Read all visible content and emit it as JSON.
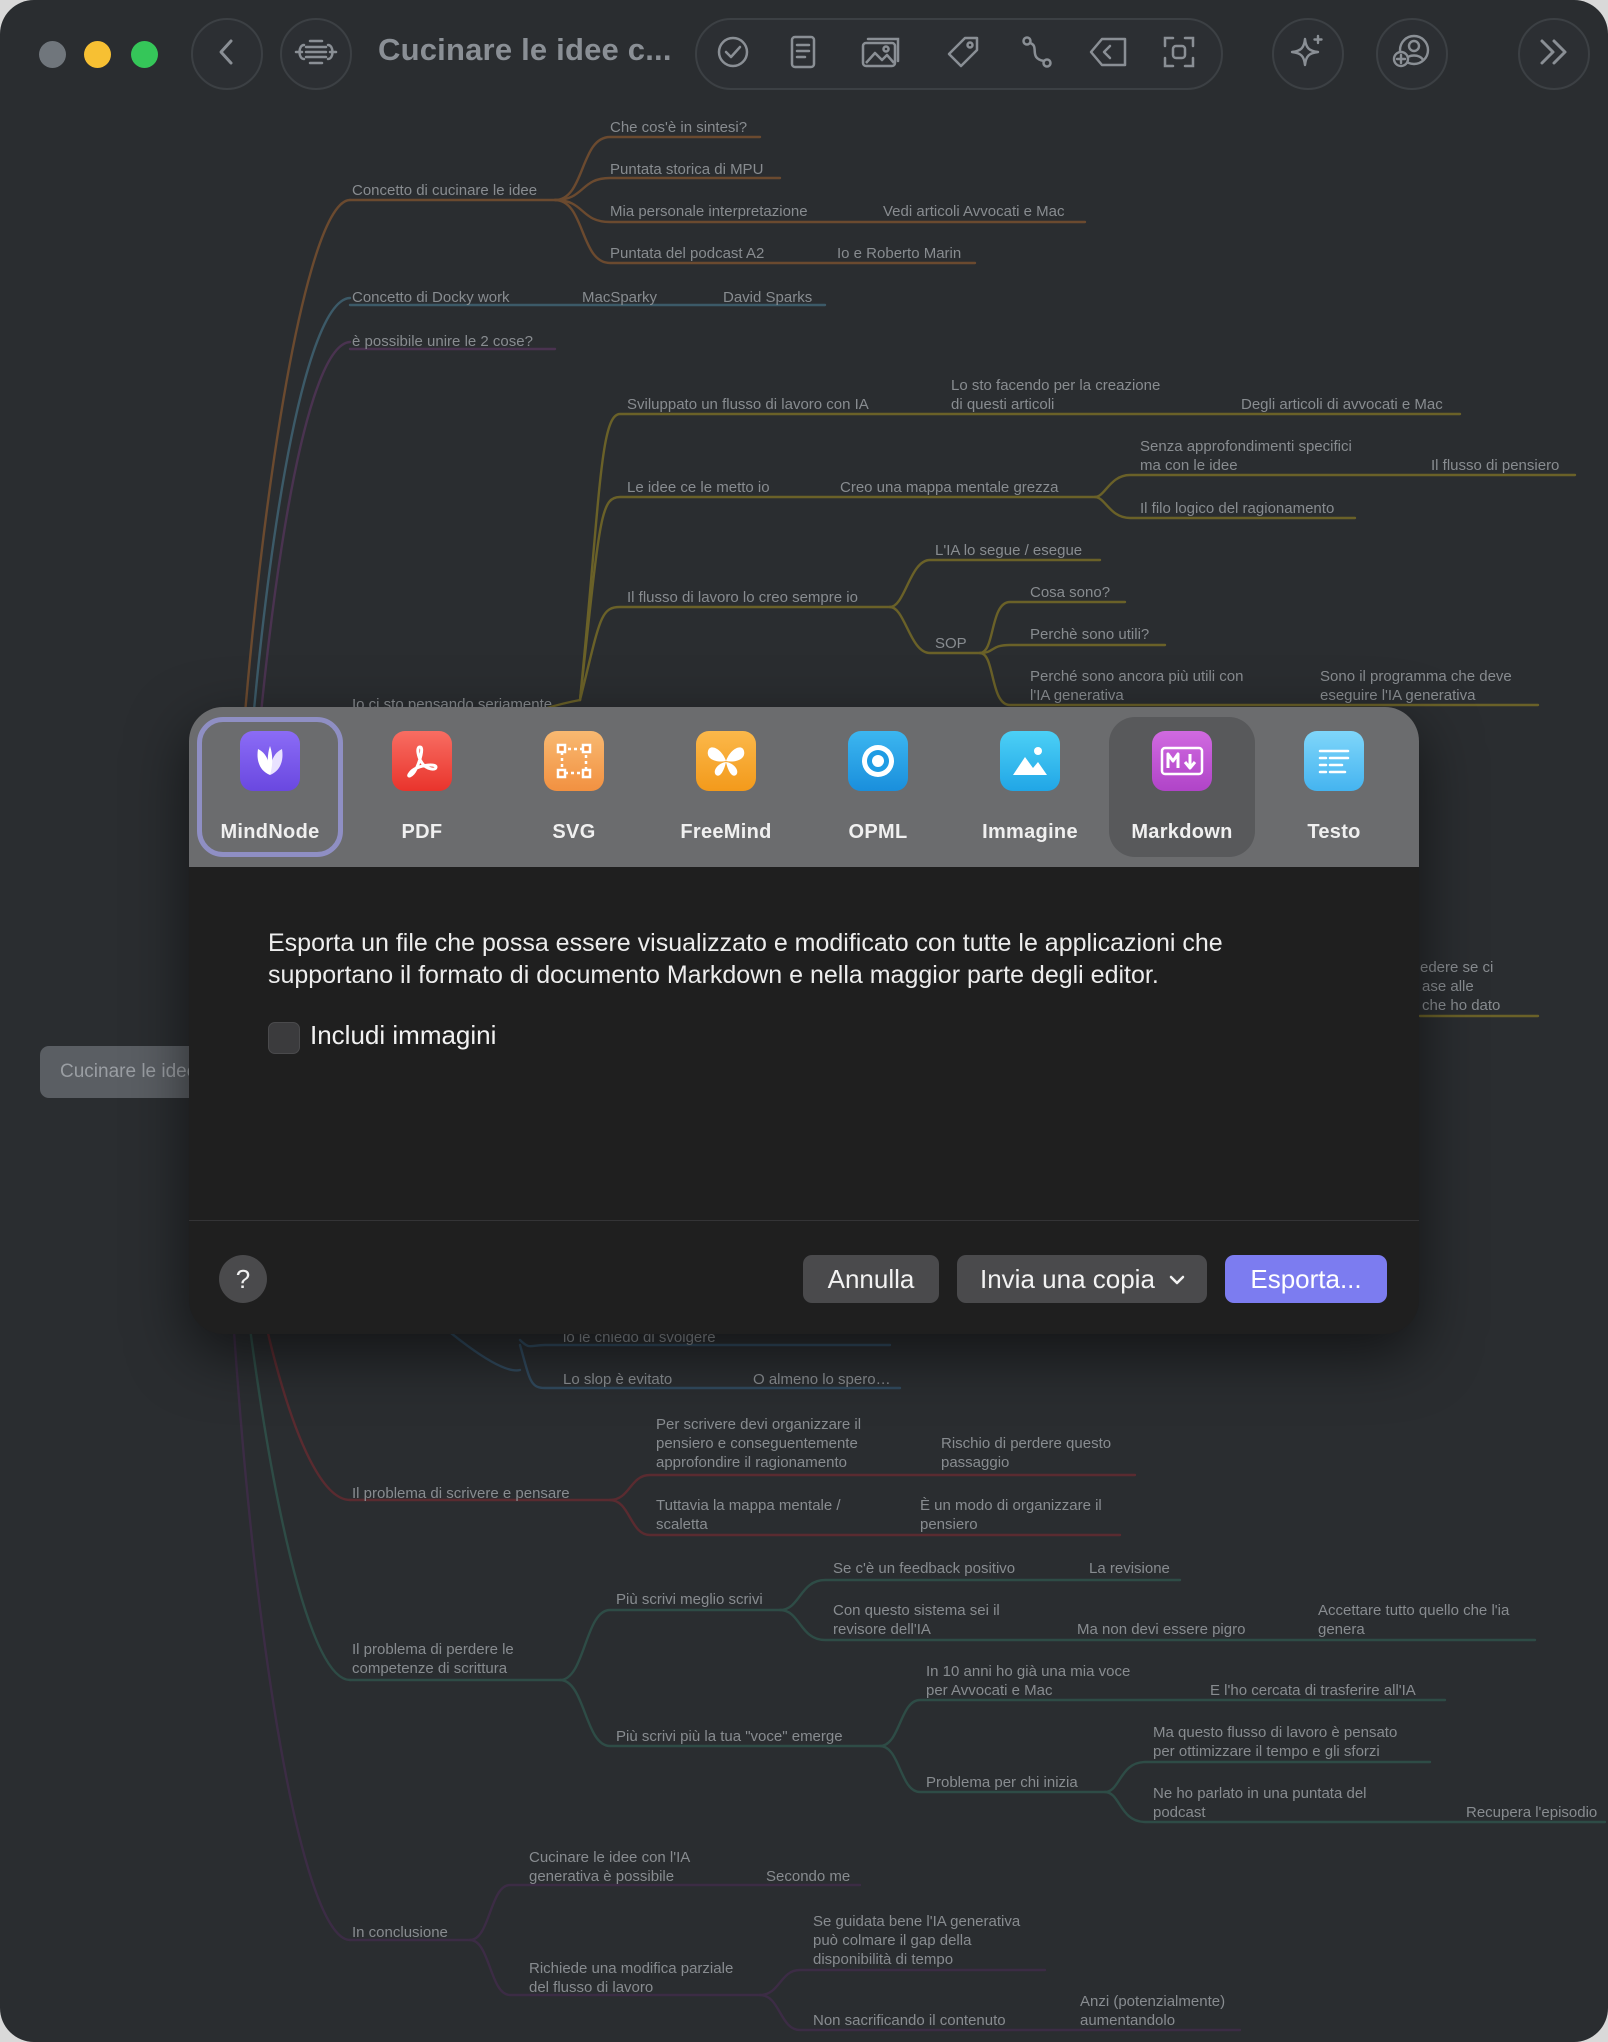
{
  "window": {
    "title": "Cucinare le idee c...",
    "colors": {
      "background": "#2a2d30",
      "accent": "#7c7cf0"
    }
  },
  "toolbar": {
    "icons": [
      "back-icon",
      "outline-icon",
      "checkmark-icon",
      "note-icon",
      "image-icon",
      "tag-icon",
      "connection-icon",
      "tag-outline-icon",
      "focus-icon",
      "sparkle-ai-icon",
      "share-collaborate-icon",
      "forward-chevrons-icon"
    ]
  },
  "mindmap": {
    "root": "Cucinare le idee",
    "nodes": {
      "n1": "Concetto di cucinare le idee",
      "n1a": "Che cos'è in sintesi?",
      "n1b": "Puntata storica di MPU",
      "n1c": "Mia personale interpretazione",
      "n1c1": "Vedi articoli Avvocati e Mac",
      "n1d": "Puntata del podcast A2",
      "n1d1": "Io e Roberto Marin",
      "n2": "Concetto di Docky work",
      "n2a": "MacSparky",
      "n2b": "David Sparks",
      "n3": "è possibile unire le 2 cose?",
      "n4": "Io ci sto pensando seriamente",
      "n4a": "Sviluppato un flusso di lavoro con IA",
      "n4a1_1": "Lo sto facendo per la creazione",
      "n4a1_2": "di questi articoli",
      "n4a2": "Degli articoli di avvocati e Mac",
      "n4b": "Le idee ce le metto io",
      "n4b1": "Creo una mappa mentale grezza",
      "n4b2_1": "Senza approfondimenti specifici",
      "n4b2_2": "ma con le idee",
      "n4b3": "Il flusso di pensiero",
      "n4b4": "Il filo logico del ragionamento",
      "n4c": "Il flusso di lavoro lo creo sempre io",
      "n4c1": "L'IA lo segue / esegue",
      "n4c2": "SOP",
      "n4c2a": "Cosa sono?",
      "n4c2b": "Perchè sono utili?",
      "n4c2c_1": "Perché sono ancora più utili con",
      "n4c2c_2": "l'IA generativa",
      "n4c2d_1": "Sono il programma che deve",
      "n4c2d_2": "eseguire l'IA generativa",
      "side_1": "edere se ci",
      "side_2": "ase alle",
      "side_3": "che ho dato",
      "n5a": "lo le chiedo di svolgere",
      "n5b": "Lo slop è evitato",
      "n5c": "O almeno lo spero…",
      "n6": "Il problema di scrivere e pensare",
      "n6a_1": "Per scrivere devi organizzare il",
      "n6a_2": "pensiero e conseguentemente",
      "n6a_3": "approfondire il ragionamento",
      "n6b_1": "Rischio di perdere questo",
      "n6b_2": "passaggio",
      "n6c_1": "Tuttavia la mappa mentale /",
      "n6c_2": "scaletta",
      "n6d_1": "È un modo di organizzare il",
      "n6d_2": "pensiero",
      "n7_1": "Il problema di perdere le",
      "n7_2": "competenze di scrittura",
      "n7a": "Più scrivi meglio scrivi",
      "n7a1": "Se c'è un feedback positivo",
      "n7a2": "La revisione",
      "n7a3_1": "Con questo sistema sei il",
      "n7a3_2": "revisore dell'IA",
      "n7a4": "Ma non devi essere pigro",
      "n7a5_1": "Accettare tutto quello che l'ia",
      "n7a5_2": "genera",
      "n7b": "Più scrivi più la tua \"voce\" emerge",
      "n7b1_1": "In 10 anni ho già una mia voce",
      "n7b1_2": "per Avvocati e Mac",
      "n7b2": "E l'ho cercata di trasferire all'IA",
      "n7b3": "Problema per chi inizia",
      "n7b4_1": "Ma questo flusso di lavoro è pensato",
      "n7b4_2": "per ottimizzare il tempo e gli sforzi",
      "n7b5_1": "Ne ho parlato in una puntata del",
      "n7b5_2": "podcast",
      "n7b6": "Recupera l'episodio",
      "n8": "In conclusione",
      "n8a_1": "Cucinare le idee con l'IA",
      "n8a_2": "generativa è possibile",
      "n8b": "Secondo me",
      "n8c_1": "Richiede una modifica parziale",
      "n8c_2": "del flusso di lavoro",
      "n8d_1": "Se guidata bene l'IA generativa",
      "n8d_2": "può colmare il gap della",
      "n8d_3": "disponibilità di tempo",
      "n8e": "Non sacrificando il contenuto",
      "n8f_1": "Anzi (potenzialmente)",
      "n8f_2": "aumentandolo"
    }
  },
  "export": {
    "formats": [
      {
        "label": "MindNode",
        "icon": "mindnode-leaf-icon",
        "color": "#7b5cf0"
      },
      {
        "label": "PDF",
        "icon": "pdf-acrobat-icon",
        "color": "#f0473e"
      },
      {
        "label": "SVG",
        "icon": "svg-frame-icon",
        "color": "#f5a04a"
      },
      {
        "label": "FreeMind",
        "icon": "freemind-butterfly-icon",
        "color": "#f5a623"
      },
      {
        "label": "OPML",
        "icon": "opml-target-icon",
        "color": "#2aa7e8"
      },
      {
        "label": "Immagine",
        "icon": "image-mountain-icon",
        "color": "#38b8f0"
      },
      {
        "label": "Markdown",
        "icon": "markdown-m-icon",
        "color": "#c256d6"
      },
      {
        "label": "Testo",
        "icon": "text-lines-icon",
        "color": "#5ec6f5"
      }
    ],
    "selected_format": "Markdown",
    "description": "Esporta un file che possa essere visualizzato e modificato con tutte le applicazioni che supportano il formato di documento Markdown e nella maggior parte degli editor.",
    "include_images_label": "Includi immagini",
    "include_images_checked": false,
    "help_label": "?",
    "cancel_label": "Annulla",
    "send_copy_label": "Invia una copia",
    "export_label": "Esporta..."
  }
}
